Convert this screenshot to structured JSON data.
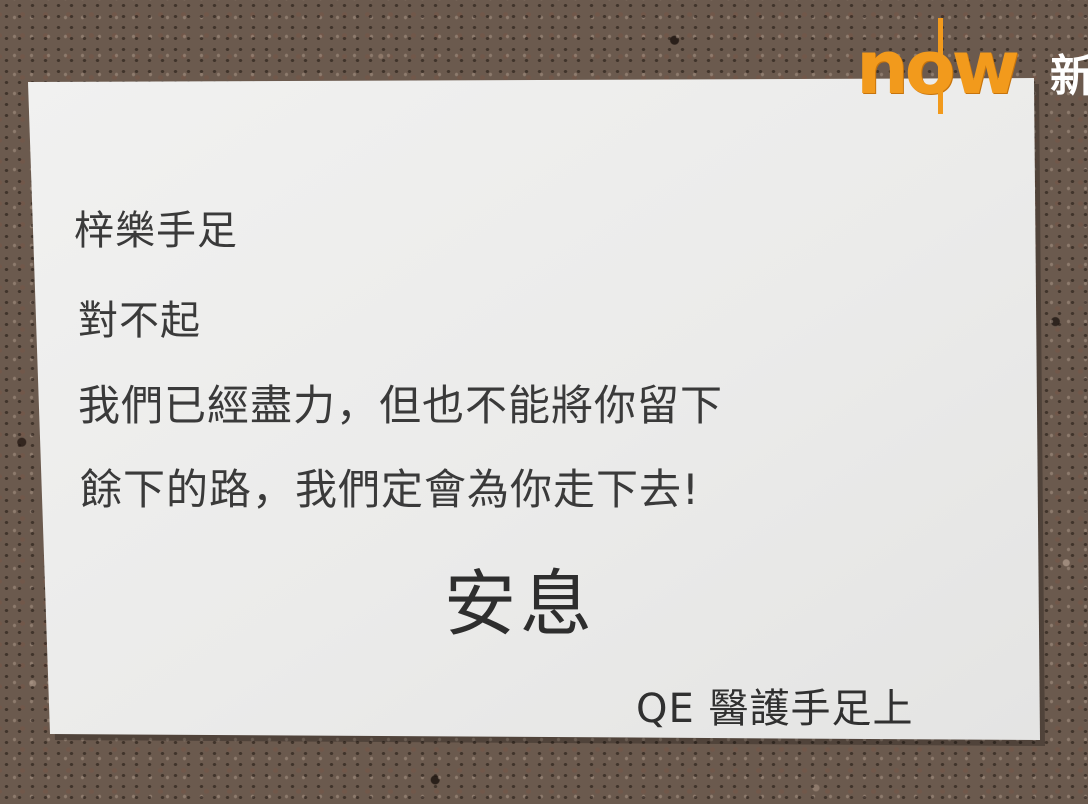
{
  "note": {
    "line1": "梓樂手足",
    "line2": "對不起",
    "line3": "我們已經盡力，但也不能將你留下",
    "line4": "餘下的路，我們定會為你走下去!",
    "rest": "安息",
    "signature": "QE 醫護手足上"
  },
  "logo": {
    "word": "now",
    "tail": "新"
  },
  "colors": {
    "background": "#6b5a4e",
    "paper": "#ededec",
    "text": "#3a3a3a",
    "logo_orange": "#f29a1c"
  }
}
